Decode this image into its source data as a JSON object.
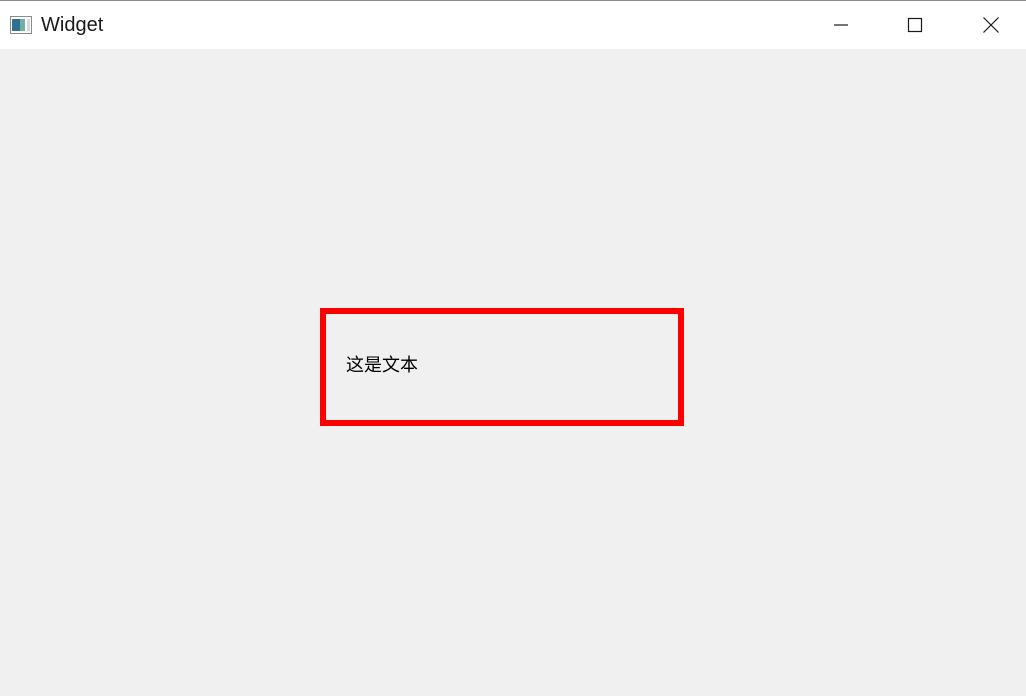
{
  "window": {
    "title": "Widget",
    "icons": {
      "app": "app-window-icon",
      "minimize": "minimize-icon",
      "maximize": "maximize-icon",
      "close": "close-icon"
    }
  },
  "content": {
    "label_text": "这是文本",
    "frame_color": "#ff0000",
    "background_color": "#f0f0f0"
  }
}
